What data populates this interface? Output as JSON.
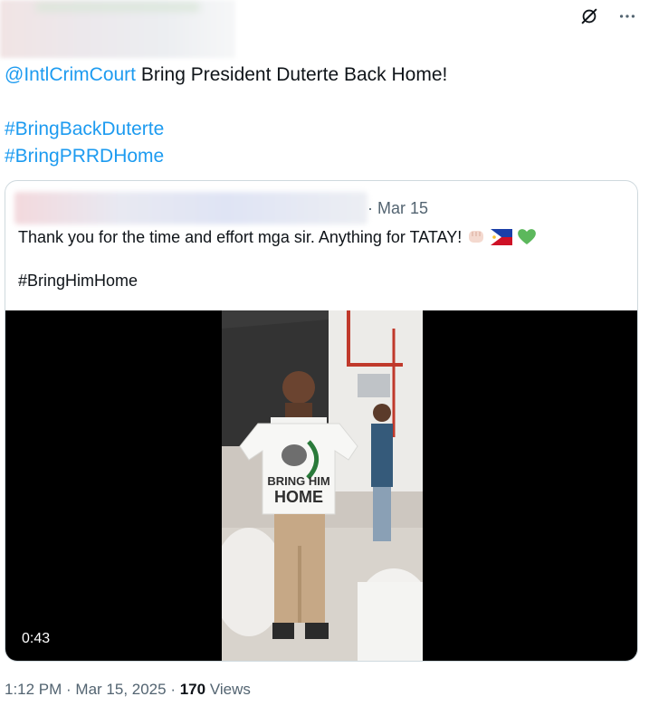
{
  "tweet": {
    "mention": "@IntlCrimCourt",
    "text": "Bring President Duterte Back Home!",
    "hashtags": [
      "#BringBackDuterte",
      "#BringPRRDHome"
    ]
  },
  "quote": {
    "date": "· Mar 15",
    "text": "Thank you for the time and effort mga sir. Anything for TATAY!",
    "emojis": [
      "fist-emoji",
      "philippines-flag-emoji",
      "green-heart-emoji"
    ],
    "hashtag": "#BringHimHome",
    "video": {
      "duration": "0:43",
      "shirt_text": "BRING HIM HOME"
    }
  },
  "meta": {
    "time": "1:12 PM",
    "sep1": " · ",
    "date": "Mar 15, 2025",
    "sep2": " · ",
    "views": "170",
    "views_label": " Views"
  },
  "colors": {
    "link": "#1d9bf0",
    "text": "#0f1419",
    "secondary": "#536471",
    "border": "#cfd9de"
  },
  "icons": [
    "grok-icon",
    "more-icon"
  ]
}
